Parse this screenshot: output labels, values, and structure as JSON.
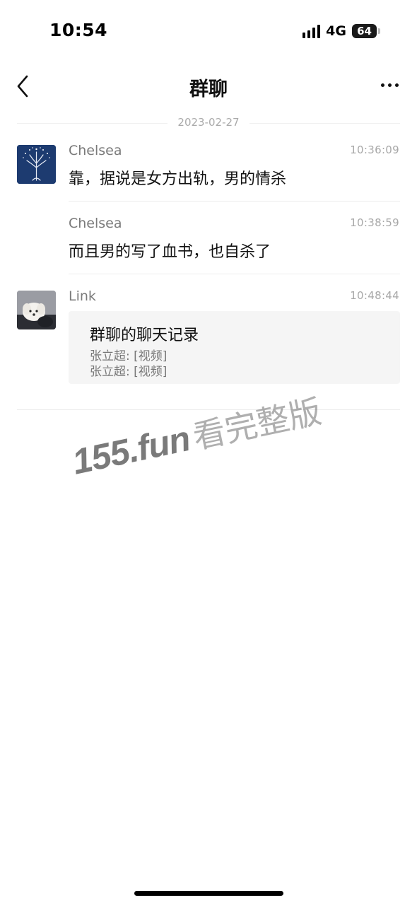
{
  "status_bar": {
    "time": "10:54",
    "network": "4G",
    "battery": "64"
  },
  "nav": {
    "title": "群聊"
  },
  "date_divider": "2023-02-27",
  "messages": [
    {
      "sender": "Chelsea",
      "time": "10:36:09",
      "text": "靠，据说是女方出轨，男的情杀"
    },
    {
      "sender": "Chelsea",
      "time": "10:38:59",
      "text": "而且男的写了血书，也自杀了"
    },
    {
      "sender": "Link",
      "time": "10:48:44",
      "card": {
        "title": "群聊的聊天记录",
        "lines": [
          "张立超: [视频]",
          "张立超: [视频]"
        ]
      }
    }
  ],
  "watermark": {
    "part1": "155.fun",
    "part2": "看完整版"
  },
  "colors": {
    "background": "#ffffff",
    "sender": "#7a7a7a",
    "time": "#a8a8a8",
    "card": "#f5f5f5"
  },
  "icons": [
    "signal-icon",
    "battery-icon",
    "back-icon",
    "more-icon",
    "avatar-tree",
    "avatar-dog"
  ]
}
